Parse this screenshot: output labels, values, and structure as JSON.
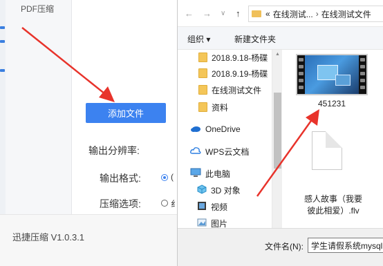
{
  "app": {
    "sidebar_item": "PDF压缩",
    "add_file_button": "添加文件",
    "resolution_label": "输出分辨率:",
    "format_label": "输出格式:",
    "compress_label": "压缩选项:",
    "format_option_partial": "(",
    "compress_option_partial": "纟",
    "version": "迅捷压缩 V1.0.3.1"
  },
  "dialog": {
    "nav": {
      "back": "←",
      "forward": "→",
      "dropdown": "∨",
      "up": "↑"
    },
    "breadcrumb": {
      "prefix": "«",
      "parent": "在线测试...",
      "current": "在线测试文件"
    },
    "toolbar": {
      "organize": "组织 ▾",
      "new_folder": "新建文件夹"
    },
    "nav_items": [
      {
        "label": "2018.9.18-杨碟",
        "icon": "folder-icon"
      },
      {
        "label": "2018.9.19-杨碟",
        "icon": "folder-icon"
      },
      {
        "label": "在线测试文件",
        "icon": "folder-icon"
      },
      {
        "label": "资料",
        "icon": "folder-icon"
      },
      {
        "label": "OneDrive",
        "icon": "cloud-icon"
      },
      {
        "label": "WPS云文档",
        "icon": "wps-cloud-icon"
      },
      {
        "label": "此电脑",
        "icon": "computer-icon"
      },
      {
        "label": "3D 对象",
        "icon": "cube-icon"
      },
      {
        "label": "视频",
        "icon": "video-icon"
      },
      {
        "label": "图片",
        "icon": "picture-icon"
      }
    ],
    "files": [
      {
        "name": "451231",
        "type": "video-thumbnail"
      },
      {
        "name_lines": [
          "感人故事（我要",
          "彼此相爱）.flv"
        ],
        "type": "generic-file"
      }
    ],
    "filename_label": "文件名(N):",
    "filename_value": "学生请假系统mysql"
  },
  "colors": {
    "accent": "#3c82f0",
    "arrow": "#e8332b",
    "folder": "#f4c659"
  }
}
